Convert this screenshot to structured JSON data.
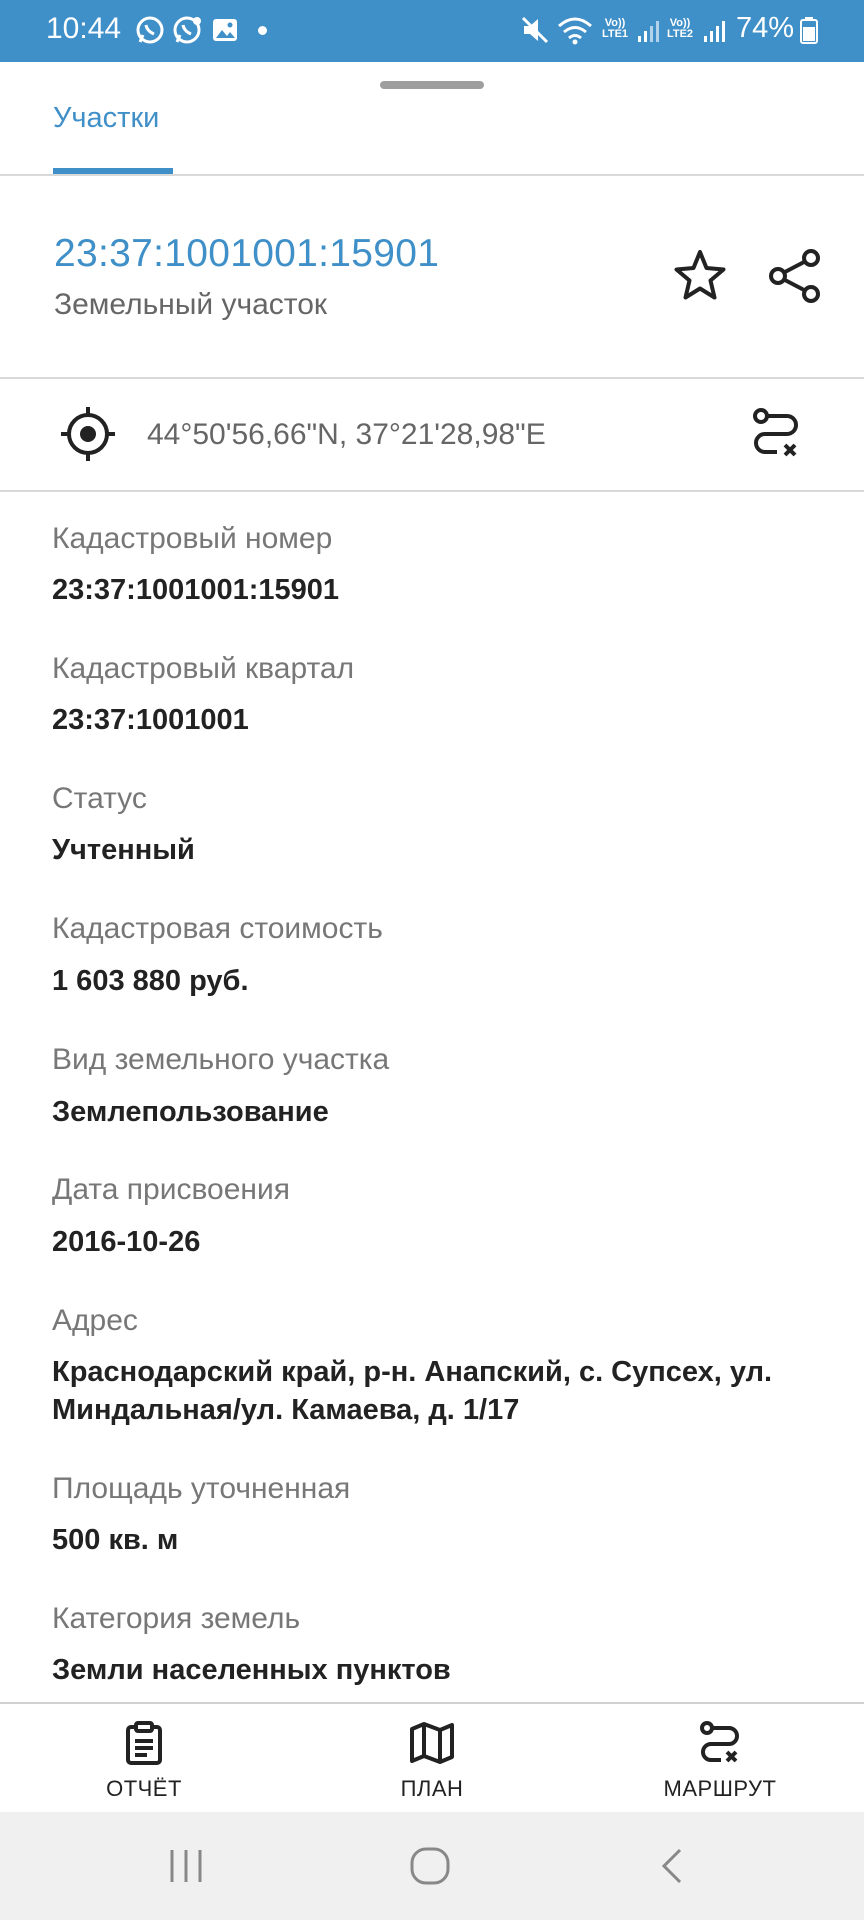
{
  "status_bar": {
    "time": "10:44",
    "battery": "74%",
    "sim1": "Vo)) LTE1",
    "sim2": "Vo)) LTE2",
    "icons": [
      "whatsapp-icon",
      "whatsapp-business-icon",
      "gallery-icon",
      "mute-icon",
      "wifi-icon",
      "signal-icon",
      "battery-icon"
    ]
  },
  "tabs": [
    {
      "label": "Участки",
      "active": true
    }
  ],
  "header": {
    "cadastral_number": "23:37:1001001:15901",
    "object_type": "Земельный участок"
  },
  "location": {
    "coordinates": "44°50'56,66\"N, 37°21'28,98\"E"
  },
  "fields": [
    {
      "label": "Кадастровый номер",
      "value": "23:37:1001001:15901"
    },
    {
      "label": "Кадастровый квартал",
      "value": "23:37:1001001"
    },
    {
      "label": "Статус",
      "value": "Учтенный"
    },
    {
      "label": "Кадастровая стоимость",
      "value": "1 603 880 руб."
    },
    {
      "label": "Вид земельного участка",
      "value": "Землепользование"
    },
    {
      "label": "Дата присвоения",
      "value": "2016-10-26"
    },
    {
      "label": "Адрес",
      "value": "Краснодарский край, р-н. Анапский, с. Супсех, ул. Миндальная/ул. Камаева, д. 1/17"
    },
    {
      "label": "Площадь уточненная",
      "value": "500 кв. м"
    },
    {
      "label": "Категория земель",
      "value": "Земли населенных пунктов"
    }
  ],
  "bottom_bar": {
    "report": "ОТЧЁТ",
    "plan": "ПЛАН",
    "route": "МАРШРУТ"
  },
  "colors": {
    "accent": "#3f8fc8",
    "text": "#222222",
    "label": "#777777"
  }
}
